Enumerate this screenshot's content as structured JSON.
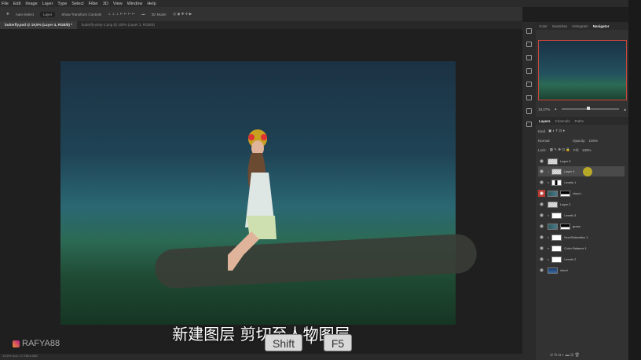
{
  "menu": [
    "File",
    "Edit",
    "Image",
    "Layer",
    "Type",
    "Select",
    "Filter",
    "3D",
    "View",
    "Window",
    "Help"
  ],
  "options": {
    "auto_select": "Auto-Select",
    "layer_select": "Layer",
    "transform": "Show Transform Controls",
    "mode3d": "3D Mode:"
  },
  "tabs": [
    {
      "label": "butterfly.psd @ 19,5% (Layer 4, RGB/8) *"
    },
    {
      "label": "butterfly-prep-1.png @ 100% (Layer 1, RGB/8)"
    }
  ],
  "status": "19,5%    Doc: 17,2M/1,68G",
  "panel_tabs": [
    "Color",
    "Swatches",
    "Histogram",
    "Navigator"
  ],
  "navigator_zoom": "19,27%",
  "layer_tabs": [
    "Layers",
    "Channels",
    "Paths"
  ],
  "filter_kind": "Kind",
  "blend_mode": "Normal",
  "opacity_label": "Opacity:",
  "opacity": "100%",
  "lock_label": "Lock:",
  "fill_label": "Fill:",
  "fill": "100%",
  "layers": [
    {
      "name": "Layer 3"
    },
    {
      "name": "Layer 4"
    },
    {
      "name": "Levels 1"
    },
    {
      "name": "cloud..."
    },
    {
      "name": "Layer 2"
    },
    {
      "name": "Levels 3"
    },
    {
      "name": "grass"
    },
    {
      "name": "Hue/Saturation 1"
    },
    {
      "name": "Color Balance 1"
    },
    {
      "name": "Levels 2"
    },
    {
      "name": "cloud"
    }
  ],
  "subtitle": "新建图层 剪切至人物图层",
  "keys": {
    "k1": "Shift",
    "plus": "+",
    "k2": "F5"
  },
  "watermark": "RAFYA88"
}
